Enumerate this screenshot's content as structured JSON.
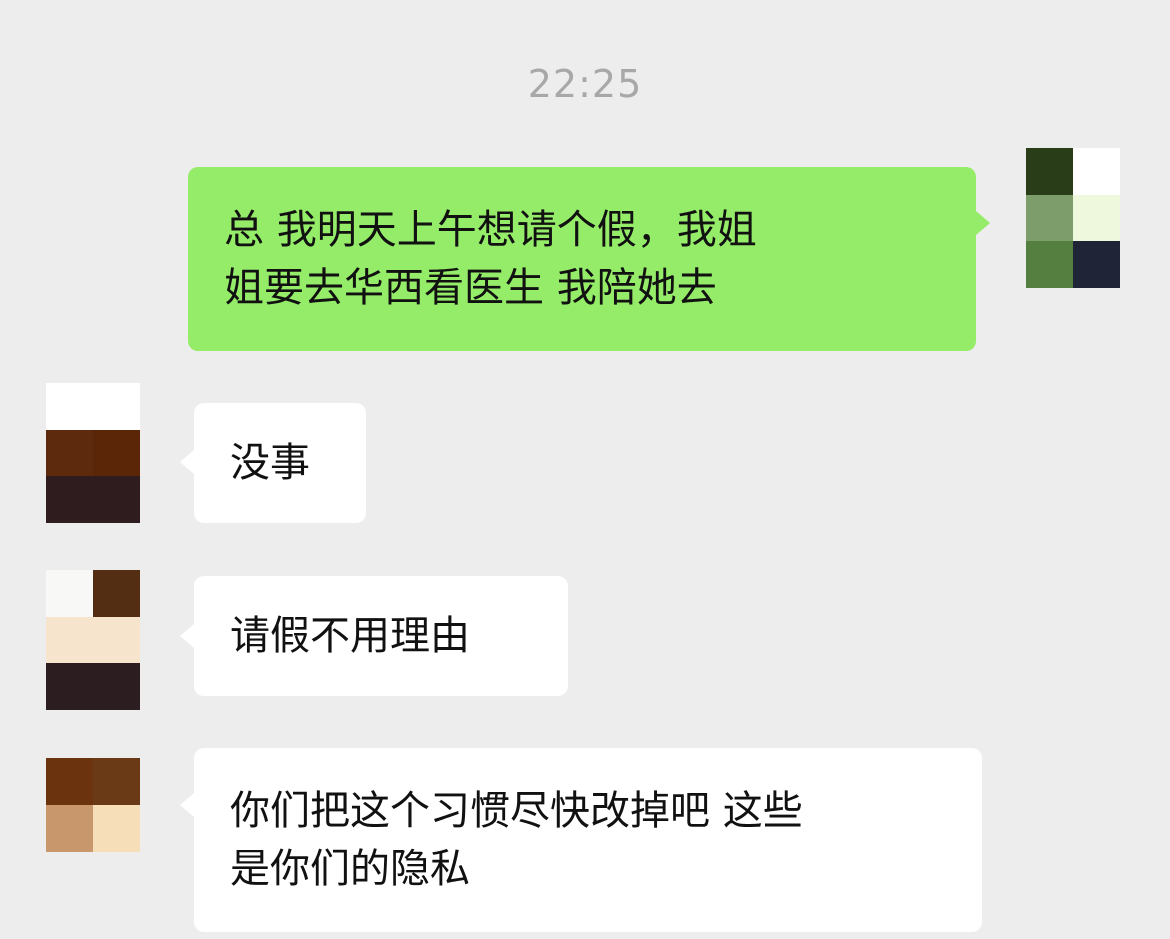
{
  "chat": {
    "timestamp": "22:25",
    "messages": [
      {
        "sender": "self",
        "text": "总 我明天上午想请个假，我姐\n姐要去华西看医生 我陪她去",
        "avatar_colors": [
          "#2a3d19",
          "#ffffff",
          "#7d9e6b",
          "#eef8dc",
          "#557f40",
          "#1f2536"
        ]
      },
      {
        "sender": "other",
        "text": "没事",
        "avatar_colors": [
          "#ffffff",
          "#ffffff",
          "#5e2a0e",
          "#5b2507",
          "#2f1c1f",
          "#2f1c1f"
        ]
      },
      {
        "sender": "other",
        "text": "请假不用理由",
        "avatar_colors": [
          "#f8f8f6",
          "#542e12",
          "#f6e5cc",
          "#f6e5cc",
          "#2c1d20",
          "#2c1d20"
        ]
      },
      {
        "sender": "other",
        "text": "你们把这个习惯尽快改掉吧 这些\n是你们的隐私",
        "avatar_colors": [
          "#6b340e",
          "#6a3a16",
          "#c8976c",
          "#f6deb8"
        ]
      }
    ]
  },
  "colors": {
    "background": "#ededed",
    "outgoing_bubble": "#95ec69",
    "incoming_bubble": "#ffffff",
    "timestamp_text": "#a8a8a8"
  }
}
